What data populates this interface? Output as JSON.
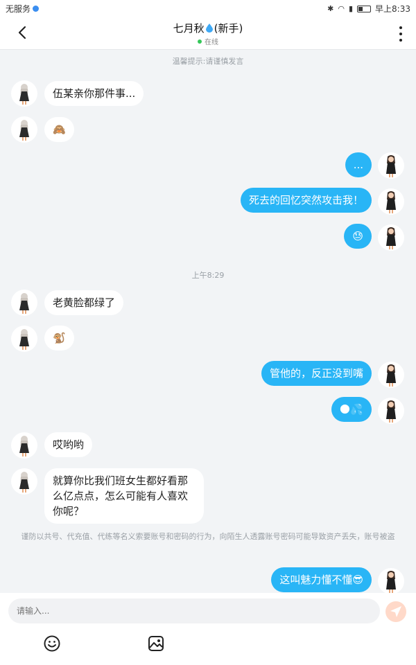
{
  "status_bar": {
    "carrier": "无服务",
    "time": "早上8:33"
  },
  "header": {
    "contact_name": "七月秋",
    "badge": "(新手)",
    "presence": "在线"
  },
  "tip": "温馨提示:请谨慎发言",
  "messages": [
    {
      "side": "in",
      "text": "伍某亲你那件事..."
    },
    {
      "side": "in",
      "text": "🙈"
    },
    {
      "side": "out",
      "text": "..."
    },
    {
      "side": "out",
      "text": "死去的回忆突然攻击我！"
    },
    {
      "side": "out",
      "text": "😓"
    },
    {
      "side": "in",
      "text": "老黄脸都绿了"
    },
    {
      "side": "in",
      "text": "🐒"
    },
    {
      "side": "out",
      "text": "管他的，反正没到嘴"
    },
    {
      "side": "out",
      "text": "🌑💦"
    },
    {
      "side": "in",
      "text": "哎哟哟"
    },
    {
      "side": "in",
      "text": "就算你比我们班女生都好看那么亿点点，怎么可能有人喜欢你呢？"
    },
    {
      "side": "out",
      "text": "这叫魅力懂不懂😎"
    }
  ],
  "timestamp": "上午8:29",
  "warning": "谨防以共号、代充值、代练等名义索要账号和密码的行为，向陌生人透露账号密码可能导致资产丢失，账号被盗",
  "composer": {
    "placeholder": "请输入..."
  },
  "colors": {
    "outgoing": "#29b5f6",
    "incoming": "#ffffff",
    "background": "#f2f4f6"
  }
}
